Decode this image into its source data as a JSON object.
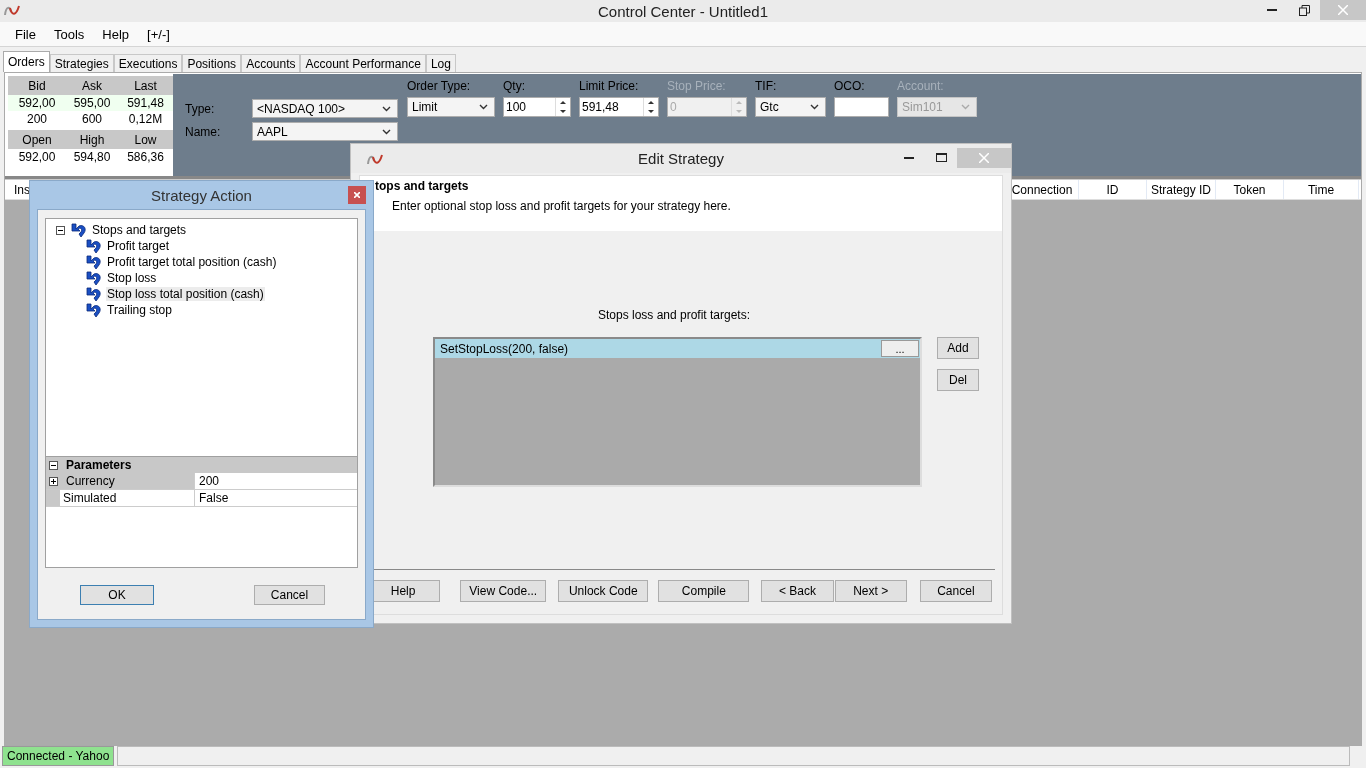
{
  "window": {
    "title": "Control Center - Untitled1"
  },
  "menu": [
    "File",
    "Tools",
    "Help",
    "[+/-]"
  ],
  "tabs": [
    {
      "label": "Orders",
      "selected": true
    },
    {
      "label": "Strategies",
      "selected": false
    },
    {
      "label": "Executions",
      "selected": false
    },
    {
      "label": "Positions",
      "selected": false
    },
    {
      "label": "Accounts",
      "selected": false
    },
    {
      "label": "Account Performance",
      "selected": false
    },
    {
      "label": "Log",
      "selected": false
    }
  ],
  "quote": {
    "sections": [
      {
        "columns": [
          "Bid",
          "Ask",
          "Last"
        ],
        "rows": [
          {
            "cells": [
              "592,00",
              "595,00",
              "591,48"
            ],
            "highlighted": true
          },
          {
            "cells": [
              "200",
              "600",
              "0,12M"
            ],
            "highlighted": false
          }
        ]
      },
      {
        "columns": [
          "Open",
          "High",
          "Low"
        ],
        "rows": [
          {
            "cells": [
              "592,00",
              "594,80",
              "586,36"
            ],
            "highlighted": false
          }
        ]
      }
    ]
  },
  "order_entry": {
    "instrument": [
      {
        "label": "Type:",
        "value": "<NASDAQ 100>"
      },
      {
        "label": "Name:",
        "value": "AAPL"
      }
    ],
    "fields": [
      {
        "label": "Order Type:",
        "kind": "dropdown",
        "value": "Limit",
        "disabled": false
      },
      {
        "label": "Qty:",
        "kind": "spinner",
        "value": "100",
        "disabled": false
      },
      {
        "label": "Limit Price:",
        "kind": "spinner",
        "value": "591,48",
        "disabled": false
      },
      {
        "label": "Stop Price:",
        "kind": "spinner",
        "value": "0",
        "disabled": true
      },
      {
        "label": "TIF:",
        "kind": "dropdown",
        "value": "Gtc",
        "disabled": false
      },
      {
        "label": "OCO:",
        "kind": "text",
        "disabled": false
      },
      {
        "label": "Account:",
        "kind": "dropdown",
        "value": "Sim101",
        "disabled": true
      }
    ]
  },
  "orders_table": {
    "columns": [
      "Ins",
      "Connection",
      "ID",
      "Strategy ID",
      "Token",
      "Time"
    ]
  },
  "edit_strategy": {
    "title": "Edit Strategy",
    "heading": "tops and targets",
    "description": "Enter optional stop loss and profit targets for your strategy here.",
    "list_label": "Stops loss and profit targets:",
    "items": [
      {
        "text": "SetStopLoss(200, false)",
        "selected": true,
        "button": "..."
      }
    ],
    "side_buttons": [
      "Add",
      "Del"
    ],
    "buttons": [
      "Help",
      "View Code...",
      "Unlock Code",
      "Compile",
      "< Back",
      "Next >",
      "Cancel"
    ]
  },
  "strategy_action": {
    "title": "Strategy Action",
    "tree": {
      "label": "Stops and targets",
      "expanded": true,
      "children": [
        {
          "label": "Profit target",
          "selected": false
        },
        {
          "label": "Profit target total position (cash)",
          "selected": false
        },
        {
          "label": "Stop loss",
          "selected": false
        },
        {
          "label": "Stop loss total position (cash)",
          "selected": true
        },
        {
          "label": "Trailing stop",
          "selected": false
        }
      ]
    },
    "properties": {
      "category": "Parameters",
      "expanded": true,
      "rows": [
        {
          "name": "Currency",
          "value": "200",
          "expandable": true
        },
        {
          "name": "Simulated",
          "value": "False",
          "expandable": false
        }
      ]
    },
    "buttons": [
      {
        "label": "OK",
        "default": true
      },
      {
        "label": "Cancel",
        "default": false
      }
    ]
  },
  "status_bar": {
    "connection": "Connected - Yahoo",
    "connected": true
  }
}
